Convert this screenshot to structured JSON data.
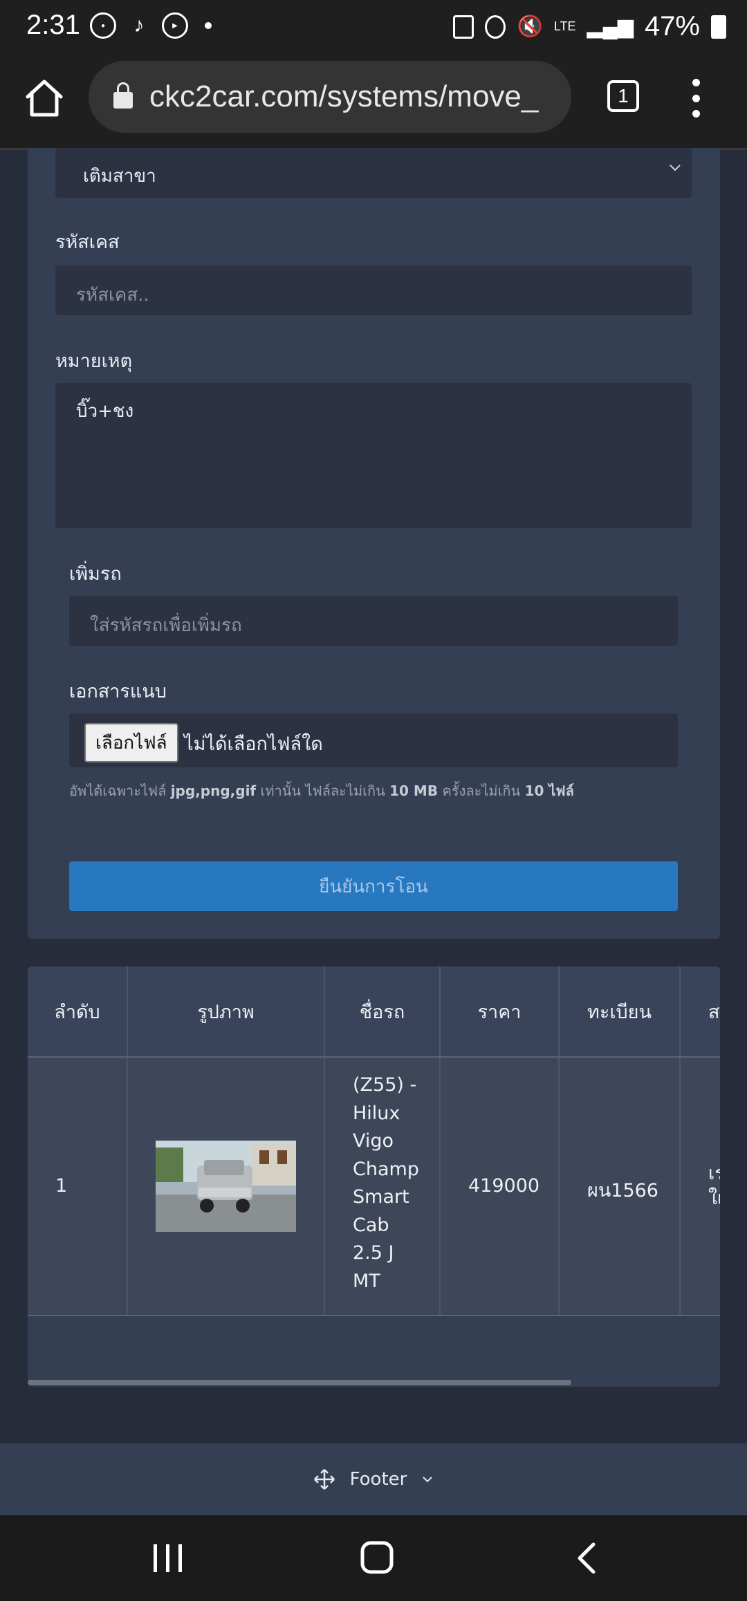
{
  "status_bar": {
    "time": "2:31",
    "network": "LTE",
    "battery": "47%"
  },
  "browser": {
    "url": "ckc2car.com/systems/move_",
    "tab_count": "1"
  },
  "form": {
    "branch_select_value": "เติมสาขา",
    "case_code_label": "รหัสเคส",
    "case_code_placeholder": "รหัสเคส..",
    "note_label": "หมายเหตุ",
    "note_value": "บิ๊ว+ชง",
    "add_car_label": "เพิ่มรถ",
    "add_car_placeholder": "ใส่รหัสรถเพื่อเพิ่มรถ",
    "attachments_label": "เอกสารแนบ",
    "file_button_label": "เลือกไฟล์",
    "file_status": "ไม่ได้เลือกไฟล์ใด",
    "hint_prefix": "อัพได้เฉพาะไฟล์ ",
    "hint_types": "jpg,png,gif",
    "hint_mid": " เท่านั้น ไฟล์ละไม่เกิน ",
    "hint_size": "10 MB",
    "hint_mid2": " ครั้งละไม่เกิน ",
    "hint_count": "10 ไฟล์",
    "submit_label": "ยืนยันการโอน"
  },
  "table": {
    "headers": [
      "ลำดับ",
      "รูปภาพ",
      "ชื่อรถ",
      "ราคา",
      "ทะเบียน",
      "ส"
    ],
    "rows": [
      {
        "index": "1",
        "name_lines": [
          "(Z55) -",
          "Hilux",
          "Vigo",
          "Champ",
          "Smart",
          "Cab",
          "2.5 J",
          "MT"
        ],
        "price": "419000",
        "plate": "ผน1566",
        "status_partial": [
          "เร",
          "ใเ"
        ]
      }
    ]
  },
  "footer": {
    "label": "Footer"
  }
}
